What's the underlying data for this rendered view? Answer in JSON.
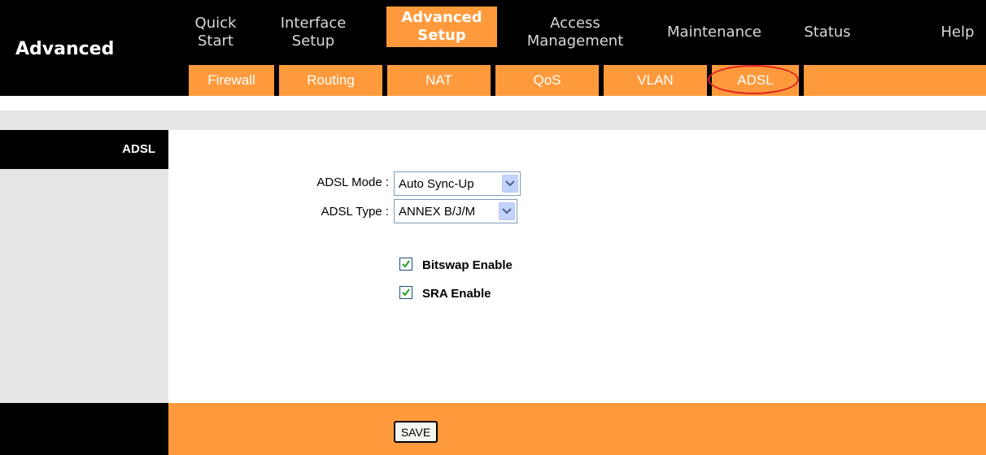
{
  "brand": {
    "title": "Advanced"
  },
  "topnav": {
    "items": [
      {
        "line1": "Quick",
        "line2": "Start"
      },
      {
        "line1": "Interface",
        "line2": "Setup"
      },
      {
        "line1": "Advanced",
        "line2": "Setup"
      },
      {
        "line1": "Access",
        "line2": "Management"
      },
      {
        "line1": "Maintenance",
        "line2": ""
      },
      {
        "line1": "Status",
        "line2": ""
      },
      {
        "line1": "Help",
        "line2": ""
      }
    ],
    "active_index": 2
  },
  "subnav": {
    "items": [
      "Firewall",
      "Routing",
      "NAT",
      "QoS",
      "VLAN",
      "ADSL"
    ],
    "highlighted": "ADSL"
  },
  "sidebar": {
    "section_label": "ADSL"
  },
  "form": {
    "adsl_mode": {
      "label": "ADSL Mode :",
      "value": "Auto Sync-Up"
    },
    "adsl_type": {
      "label": "ADSL Type :",
      "value": "ANNEX B/J/M"
    },
    "bitswap": {
      "label": "Bitswap Enable",
      "checked": true
    },
    "sra": {
      "label": "SRA Enable",
      "checked": true
    }
  },
  "footer": {
    "save_label": "SAVE"
  },
  "colors": {
    "accent_orange": "#ff9a3c",
    "black": "#000000",
    "light_gray": "#e6e6e6",
    "highlight_circle": "#e02020"
  }
}
